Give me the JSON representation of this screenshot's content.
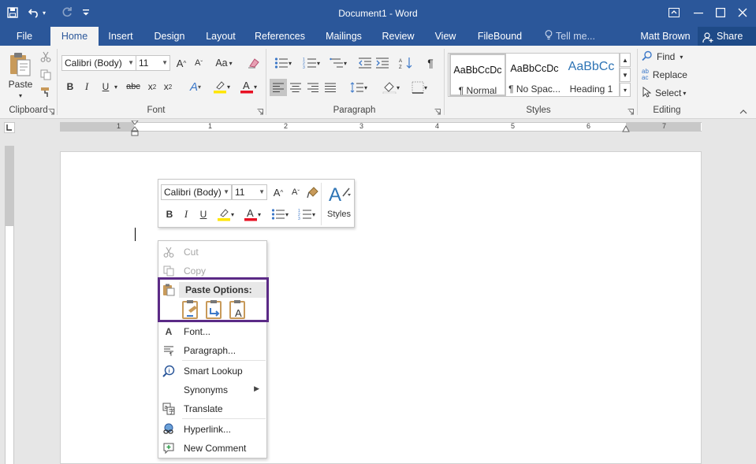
{
  "titlebar": {
    "title": "Document1 - Word"
  },
  "tabs": [
    {
      "label": "File"
    },
    {
      "label": "Home"
    },
    {
      "label": "Insert"
    },
    {
      "label": "Design"
    },
    {
      "label": "Layout"
    },
    {
      "label": "References"
    },
    {
      "label": "Mailings"
    },
    {
      "label": "Review"
    },
    {
      "label": "View"
    },
    {
      "label": "FileBound"
    }
  ],
  "tell_me": "Tell me...",
  "user": "Matt Brown",
  "share": "Share",
  "ribbon": {
    "paste_label": "Paste",
    "groups": {
      "clipboard": "Clipboard",
      "font": "Font",
      "paragraph": "Paragraph",
      "styles": "Styles",
      "editing": "Editing"
    },
    "font_name": "Calibri (Body)",
    "font_size": "11",
    "styles": [
      {
        "preview": "AaBbCcDc",
        "name": "¶ Normal"
      },
      {
        "preview": "AaBbCcDc",
        "name": "¶ No Spac..."
      },
      {
        "preview": "AaBbCc",
        "name": "Heading 1"
      }
    ],
    "editing": {
      "find": "Find",
      "replace": "Replace",
      "select": "Select"
    }
  },
  "ruler_numbers": [
    "1",
    "1",
    "2",
    "3",
    "4",
    "5",
    "6",
    "7"
  ],
  "mini_toolbar": {
    "font_name": "Calibri (Body)",
    "font_size": "11",
    "styles_label": "Styles"
  },
  "context_menu": {
    "cut": "Cut",
    "copy": "Copy",
    "paste_options": "Paste Options:",
    "font": "Font...",
    "paragraph": "Paragraph...",
    "smart_lookup": "Smart Lookup",
    "synonyms": "Synonyms",
    "translate": "Translate",
    "hyperlink": "Hyperlink...",
    "new_comment": "New Comment"
  },
  "colors": {
    "accent": "#2b579a",
    "highlight_frame": "#5b2a86",
    "font_color": "#e81123",
    "highlighter": "#ffe600"
  }
}
